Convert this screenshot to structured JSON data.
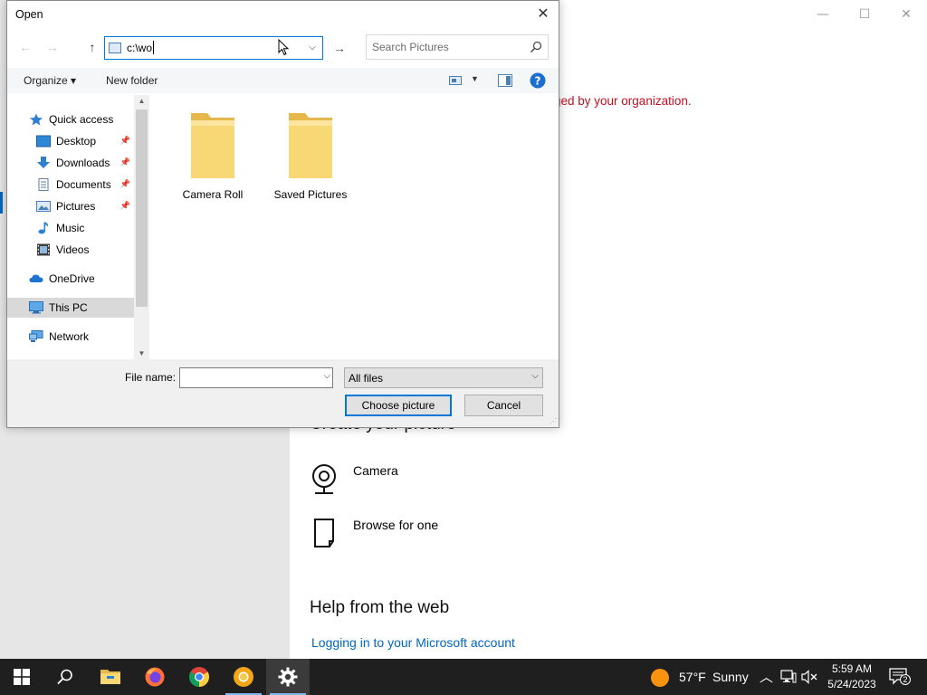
{
  "settings": {
    "org_message": "ged by your organization.",
    "create_title": "Create your picture",
    "options": [
      {
        "label": "Camera",
        "icon": "camera-icon"
      },
      {
        "label": "Browse for one",
        "icon": "file-icon"
      }
    ],
    "help_title": "Help from the web",
    "help_link": "Logging in to your Microsoft account",
    "controls": {
      "minimize": "—",
      "maximize": "☐",
      "close": "✕"
    }
  },
  "dialog": {
    "title": "Open",
    "close": "✕",
    "address_value": "c:\\wo",
    "search_placeholder": "Search Pictures",
    "toolbar": {
      "organize": "Organize ▾",
      "new_folder": "New folder"
    },
    "nav": [
      {
        "label": "Quick access",
        "icon": "star-icon",
        "pinned": false
      },
      {
        "label": "Desktop",
        "icon": "desktop-icon",
        "pinned": true
      },
      {
        "label": "Downloads",
        "icon": "download-icon",
        "pinned": true
      },
      {
        "label": "Documents",
        "icon": "documents-icon",
        "pinned": true
      },
      {
        "label": "Pictures",
        "icon": "pictures-icon",
        "pinned": true
      },
      {
        "label": "Music",
        "icon": "music-icon",
        "pinned": false
      },
      {
        "label": "Videos",
        "icon": "video-icon",
        "pinned": false
      },
      {
        "label": "OneDrive",
        "icon": "cloud-icon",
        "pinned": false
      },
      {
        "label": "This PC",
        "icon": "pc-icon",
        "pinned": false
      },
      {
        "label": "Network",
        "icon": "network-icon",
        "pinned": false
      }
    ],
    "folders": [
      {
        "label": "Camera Roll"
      },
      {
        "label": "Saved Pictures"
      }
    ],
    "filename_label": "File name:",
    "filename_value": "",
    "filetype_value": "All files",
    "choose_button": "Choose picture",
    "cancel_button": "Cancel"
  },
  "taskbar": {
    "weather_temp": "57°F",
    "weather_desc": "Sunny",
    "time": "5:59 AM",
    "date": "5/24/2023",
    "notification_count": "2"
  }
}
